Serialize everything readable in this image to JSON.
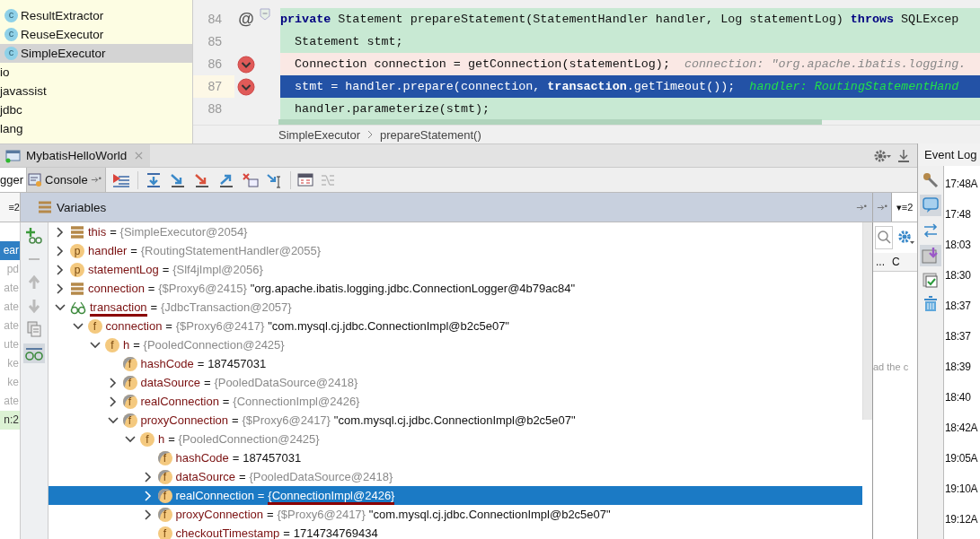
{
  "project_tree": {
    "items": [
      {
        "label": "ResultExtractor",
        "kind": "class",
        "badge": "c",
        "selected": false
      },
      {
        "label": "ReuseExecutor",
        "kind": "class",
        "badge": "c",
        "selected": false
      },
      {
        "label": "SimpleExecutor",
        "kind": "class",
        "badge": "c",
        "selected": true
      },
      {
        "label": "io",
        "kind": "package",
        "selected": false
      },
      {
        "label": "javassist",
        "kind": "package",
        "selected": false
      },
      {
        "label": "jdbc",
        "kind": "package",
        "selected": false
      },
      {
        "label": "lang",
        "kind": "package",
        "selected": false
      }
    ]
  },
  "editor": {
    "lines": [
      {
        "number": "84",
        "gutter": "@",
        "breakpoint": false,
        "current": false,
        "tokens": [
          {
            "kind": "keyword",
            "text": "private"
          },
          {
            "kind": "plain",
            "text": " Statement prepareStatement(StatementHandler handler, Log statementLog) "
          },
          {
            "kind": "keyword",
            "text": "throws"
          },
          {
            "kind": "plain",
            "text": " SQLExcep"
          }
        ]
      },
      {
        "number": "85",
        "breakpoint": false,
        "current": false,
        "tokens": [
          {
            "kind": "plain",
            "text": "  Statement stmt;"
          }
        ]
      },
      {
        "number": "86",
        "breakpoint": true,
        "current": false,
        "tokens": [
          {
            "kind": "plain",
            "text": "  Connection connection = getConnection(statementLog);  "
          },
          {
            "kind": "hint",
            "text": "connection: \"org.apache.ibatis.logging."
          }
        ]
      },
      {
        "number": "87",
        "breakpoint": true,
        "current": true,
        "tokens": [
          {
            "kind": "plain",
            "text": "  stmt = handler.prepare(connection, "
          },
          {
            "kind": "bold",
            "text": "transaction"
          },
          {
            "kind": "plain",
            "text": ".getTimeout());  "
          },
          {
            "kind": "hint",
            "text": "handler: RoutingStatementHand"
          }
        ]
      },
      {
        "number": "88",
        "breakpoint": false,
        "current": false,
        "tokens": [
          {
            "kind": "plain",
            "text": "  handler.parameterize(stmt);"
          }
        ]
      }
    ],
    "breadcrumb": [
      "SimpleExecutor",
      "prepareStatement()"
    ]
  },
  "debug": {
    "session": {
      "label": "MybatisHelloWorld"
    },
    "tabs": [
      {
        "label": "gger",
        "selected": true
      },
      {
        "label": "Console",
        "selected": false
      }
    ],
    "layout_left": "≡2",
    "frames": [
      {
        "text": "ear",
        "selected": true,
        "library": false
      },
      {
        "text": "pd",
        "selected": false,
        "library": true
      },
      {
        "text": "ate",
        "selected": false,
        "library": true
      },
      {
        "text": "ate",
        "selected": false,
        "library": true
      },
      {
        "text": "ate",
        "selected": false,
        "library": true
      },
      {
        "text": "ute",
        "selected": false,
        "library": true
      },
      {
        "text": "ke",
        "selected": false,
        "library": true
      },
      {
        "text": "ke",
        "selected": false,
        "library": true
      },
      {
        "text": "ate",
        "selected": false,
        "library": true
      },
      {
        "text": "n:2",
        "selected": false,
        "library": false
      }
    ],
    "variables": {
      "title": "Variables",
      "layout_button": "▾≡2",
      "tree": [
        {
          "kind": "stack",
          "name": "this",
          "op": "=",
          "type": "{SimpleExecutor@2054}",
          "expanded": false,
          "selected": false
        },
        {
          "kind": "param",
          "badge": "p",
          "name": "handler",
          "op": "=",
          "type": "{RoutingStatementHandler@2055}",
          "expanded": false,
          "selected": false
        },
        {
          "kind": "param",
          "badge": "p",
          "name": "statementLog",
          "op": "=",
          "type": "{Slf4jImpl@2056}",
          "expanded": false,
          "selected": false
        },
        {
          "kind": "stack",
          "name": "connection",
          "op": "=",
          "type": "{$Proxy6@2415}",
          "value": "\"org.apache.ibatis.logging.jdbc.ConnectionLogger@4b79ac84\"",
          "expanded": false,
          "selected": false
        },
        {
          "kind": "watch",
          "name": "transaction",
          "op": "=",
          "type": "{JdbcTransaction@2057}",
          "expanded": true,
          "selected": false,
          "name_underlined": true,
          "children": [
            {
              "kind": "field",
              "badge": "f",
              "name": "connection",
              "op": "=",
              "type": "{$Proxy6@2417}",
              "value": "\"com.mysql.cj.jdbc.ConnectionImpl@b2c5e07\"",
              "expanded": true,
              "selected": false,
              "children": [
                {
                  "kind": "field",
                  "badge": "f",
                  "name": "h",
                  "op": "=",
                  "type": "{PooledConnection@2425}",
                  "expanded": true,
                  "selected": false,
                  "children": [
                    {
                      "kind": "final",
                      "badge": "f",
                      "name": "hashCode",
                      "op": "=",
                      "value": "187457031",
                      "selected": false
                    },
                    {
                      "kind": "final",
                      "badge": "f",
                      "name": "dataSource",
                      "op": "=",
                      "type": "{PooledDataSource@2418}",
                      "expanded": false,
                      "selected": false
                    },
                    {
                      "kind": "final",
                      "badge": "f",
                      "name": "realConnection",
                      "op": "=",
                      "type": "{ConnectionImpl@2426}",
                      "expanded": false,
                      "selected": false
                    },
                    {
                      "kind": "final",
                      "badge": "f",
                      "name": "proxyConnection",
                      "op": "=",
                      "type": "{$Proxy6@2417}",
                      "value": "\"com.mysql.cj.jdbc.ConnectionImpl@b2c5e07\"",
                      "expanded": true,
                      "selected": false,
                      "children": [
                        {
                          "kind": "field",
                          "badge": "f",
                          "name": "h",
                          "op": "=",
                          "type": "{PooledConnection@2425}",
                          "expanded": true,
                          "selected": false,
                          "children": [
                            {
                              "kind": "final",
                              "badge": "f",
                              "name": "hashCode",
                              "op": "=",
                              "value": "187457031",
                              "selected": false
                            },
                            {
                              "kind": "final",
                              "badge": "f",
                              "name": "dataSource",
                              "op": "=",
                              "type": "{PooledDataSource@2418}",
                              "expanded": false,
                              "selected": false
                            },
                            {
                              "kind": "final",
                              "badge": "f",
                              "name": "realConnection",
                              "op": "=",
                              "type": "{ConnectionImpl@2426}",
                              "expanded": false,
                              "selected": true,
                              "type_underlined": true
                            },
                            {
                              "kind": "final",
                              "badge": "f",
                              "name": "proxyConnection",
                              "op": "=",
                              "type": "{$Proxy6@2417}",
                              "value": "\"com.mysql.cj.jdbc.ConnectionImpl@b2c5e07\"",
                              "expanded": false,
                              "selected": false
                            },
                            {
                              "kind": "field",
                              "badge": "f",
                              "name": "checkoutTimestamp",
                              "op": "=",
                              "value": "1714734769434",
                              "selected": false
                            }
                          ]
                        }
                      ]
                    }
                  ]
                }
              ]
            }
          ]
        }
      ]
    },
    "side_panel": {
      "columns": [
        "...",
        "C"
      ],
      "hint": "ad the c"
    }
  },
  "event_log": {
    "title": "Event Log",
    "times": [
      "17:48A",
      "17:48",
      "18:03",
      "18:30",
      "18:37",
      "18:37",
      "18:39",
      "18:40",
      "18:42A",
      "19:05A",
      "19:10A",
      "19:12A"
    ]
  }
}
